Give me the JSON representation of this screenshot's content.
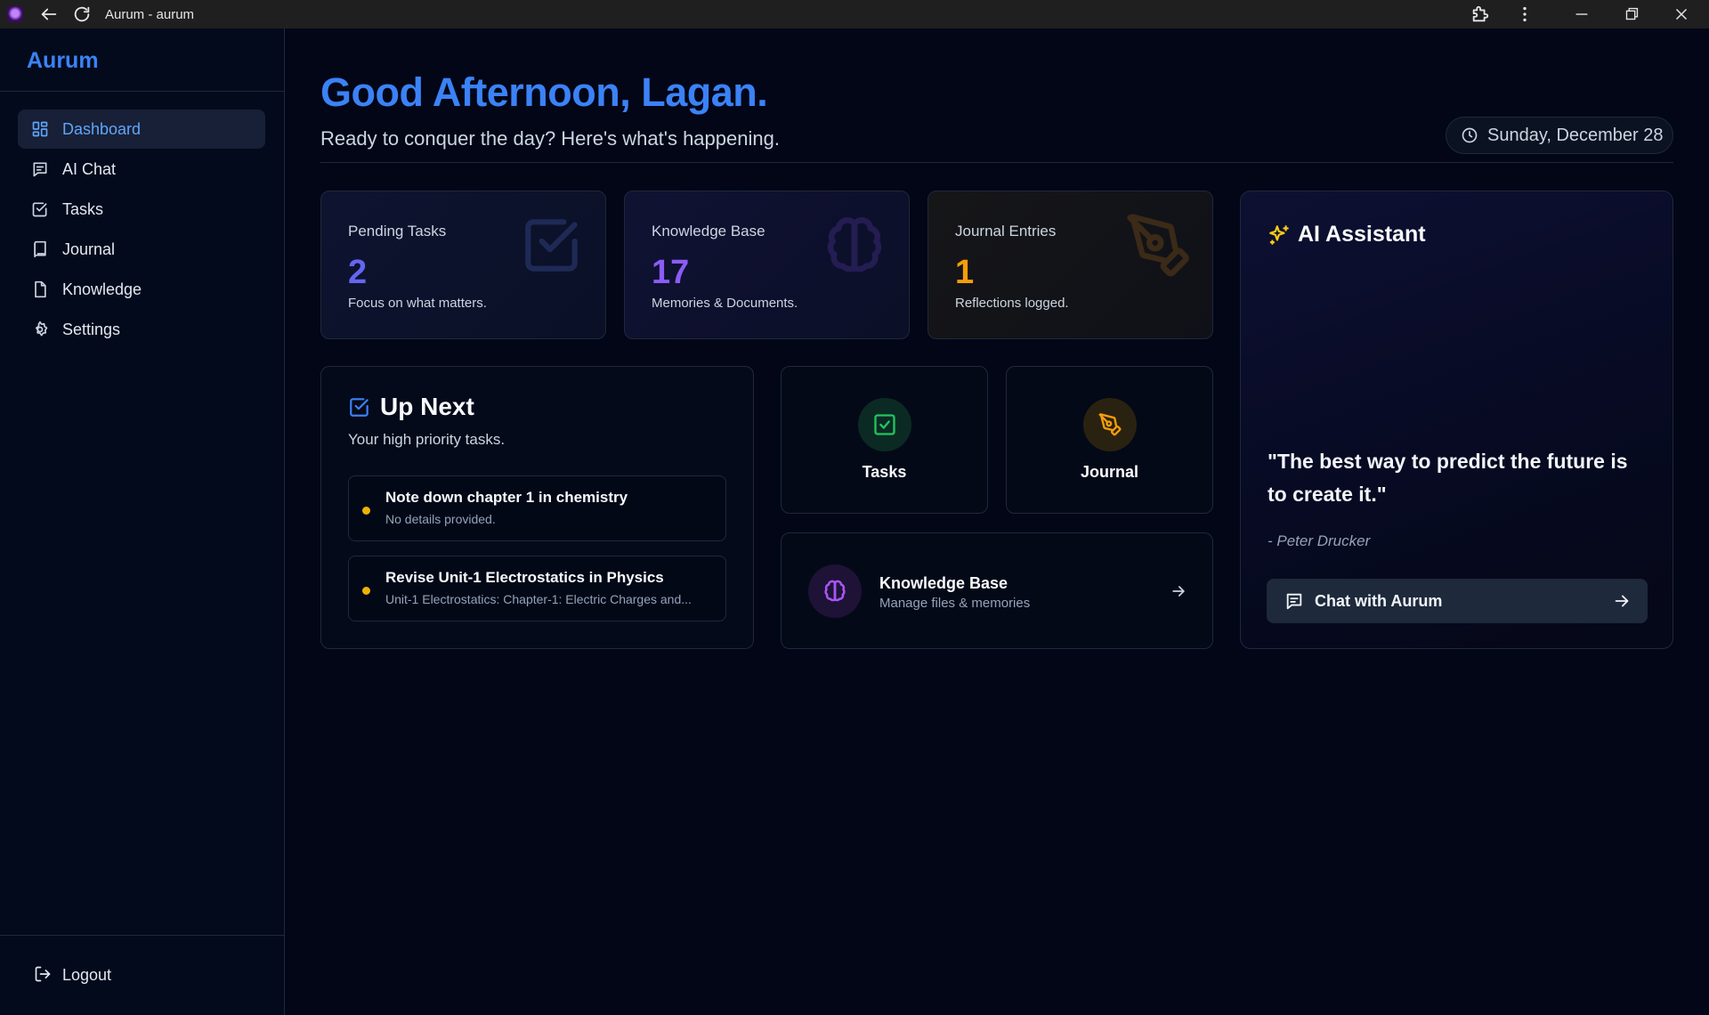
{
  "window": {
    "title": "Aurum - aurum"
  },
  "sidebar": {
    "brand": "Aurum",
    "items": [
      {
        "label": "Dashboard",
        "icon": "dashboard-icon",
        "active": true
      },
      {
        "label": "AI Chat",
        "icon": "chat-icon",
        "active": false
      },
      {
        "label": "Tasks",
        "icon": "checkbox-icon",
        "active": false
      },
      {
        "label": "Journal",
        "icon": "book-icon",
        "active": false
      },
      {
        "label": "Knowledge",
        "icon": "file-icon",
        "active": false
      },
      {
        "label": "Settings",
        "icon": "gear-icon",
        "active": false
      }
    ],
    "logout_label": "Logout"
  },
  "header": {
    "greeting": "Good Afternoon, Lagan.",
    "subtitle": "Ready to conquer the day? Here's what's happening.",
    "date": "Sunday, December 28"
  },
  "stats": {
    "tasks": {
      "label": "Pending Tasks",
      "value": "2",
      "desc": "Focus on what matters.",
      "color": "#6366f1"
    },
    "knowledge": {
      "label": "Knowledge Base",
      "value": "17",
      "desc": "Memories & Documents.",
      "color": "#8b5cf6"
    },
    "journal": {
      "label": "Journal Entries",
      "value": "1",
      "desc": "Reflections logged.",
      "color": "#f59e0b"
    }
  },
  "up_next": {
    "title": "Up Next",
    "subtitle": "Your high priority tasks.",
    "tasks": [
      {
        "title": "Note down chapter 1 in chemistry",
        "desc": "No details provided."
      },
      {
        "title": "Revise Unit-1 Electrostatics in Physics",
        "desc": "Unit-1 Electrostatics: Chapter-1: Electric Charges and..."
      }
    ]
  },
  "quick_actions": {
    "tasks_label": "Tasks",
    "journal_label": "Journal",
    "knowledge": {
      "title": "Knowledge Base",
      "subtitle": "Manage files & memories"
    }
  },
  "ai_assistant": {
    "title": "AI Assistant",
    "quote": "\"The best way to predict the future is to create it.\"",
    "author": "- Peter Drucker",
    "button_label": "Chat with Aurum"
  },
  "colors": {
    "accent": "#3b82f6",
    "background": "#020617",
    "priority_dot": "#eab308",
    "tasks_green": "#22c55e",
    "journal_amber": "#f59e0b",
    "knowledge_purple": "#a855f7"
  }
}
